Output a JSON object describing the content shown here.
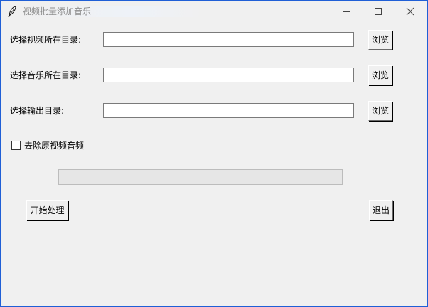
{
  "window": {
    "title": "视频批量添加音乐",
    "app_icon": "feather-icon",
    "controls": {
      "minimize": "minimize-icon",
      "maximize": "maximize-icon",
      "close": "close-icon"
    }
  },
  "form": {
    "video_dir": {
      "label": "选择视频所在目录:",
      "value": "",
      "browse_label": "浏览"
    },
    "music_dir": {
      "label": "选择音乐所在目录:",
      "value": "",
      "browse_label": "浏览"
    },
    "output_dir": {
      "label": "选择输出目录:",
      "value": "",
      "browse_label": "浏览"
    },
    "remove_audio": {
      "label": "去除原视频音频",
      "checked": false
    },
    "progress": 0
  },
  "actions": {
    "start_label": "开始处理",
    "exit_label": "退出"
  },
  "colors": {
    "window_border": "#1f5fd6",
    "background": "#f0f0f0",
    "title_text": "#8c8c8c"
  }
}
